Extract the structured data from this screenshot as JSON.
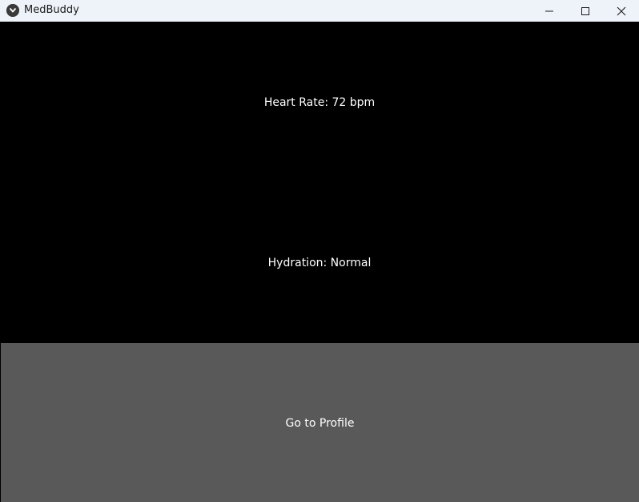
{
  "window": {
    "title": "MedBuddy",
    "icons": {
      "app": "app-logo-icon",
      "minimize": "minimize-icon",
      "maximize": "maximize-icon",
      "close": "close-icon"
    }
  },
  "main": {
    "heart_rate_label": "Heart Rate: 72 bpm",
    "hydration_label": "Hydration: Normal",
    "profile_button_label": "Go to Profile"
  },
  "colors": {
    "background": "#000000",
    "titlebar": "#eef3fa",
    "button": "#595959",
    "text": "#ffffff"
  }
}
